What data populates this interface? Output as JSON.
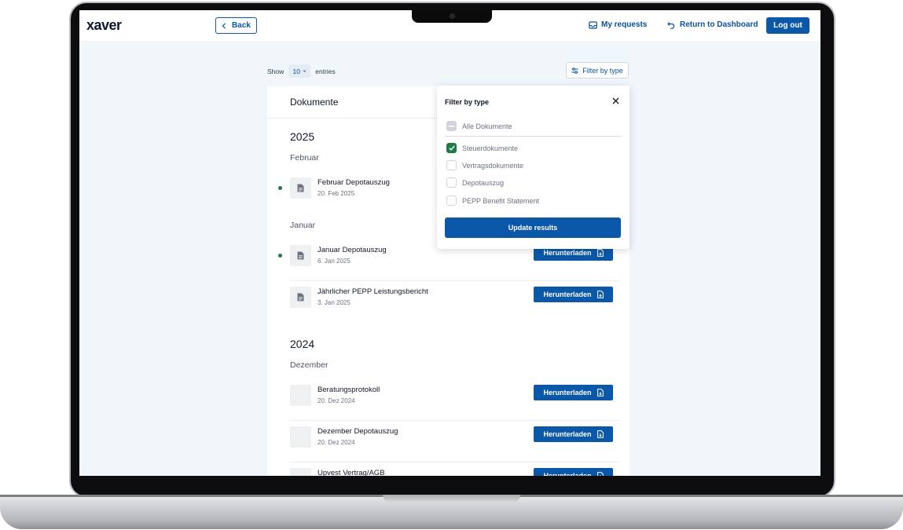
{
  "app": {
    "logo": "xaver"
  },
  "nav": {
    "back_label": "Back",
    "my_requests_label": "My requests",
    "return_label": "Return to Dashboard",
    "logout_label": "Log out"
  },
  "controls": {
    "show_label": "Show",
    "entries_value": "10",
    "entries_label": "entries",
    "filter_label": "Filter by type"
  },
  "panel": {
    "title": "Dokumente",
    "download_label": "Herunterladen",
    "groups": [
      {
        "year": "2025",
        "months": [
          {
            "name": "Februar",
            "docs": [
              {
                "name": "Februar Depotauszug",
                "date": "20. Feb 2025",
                "unread": true
              }
            ]
          },
          {
            "name": "Januar",
            "docs": [
              {
                "name": "Januar Depotauszug",
                "date": "6. Jan 2025",
                "unread": true
              },
              {
                "name": "Jährlicher PEPP Leistungsbericht",
                "date": "3. Jan 2025",
                "unread": false
              }
            ]
          }
        ]
      },
      {
        "year": "2024",
        "months": [
          {
            "name": "Dezember",
            "docs": [
              {
                "name": "Beratungsprotokoll",
                "date": "20. Dez 2024",
                "unread": false
              },
              {
                "name": "Dezember Depotauszug",
                "date": "20. Dez 2024",
                "unread": false
              },
              {
                "name": "Upvest Vertrag/AGB",
                "date": "",
                "unread": false
              }
            ]
          }
        ]
      }
    ]
  },
  "filter_popup": {
    "title": "Filter by type",
    "all_option": {
      "label": "Alle Dokumente",
      "state": "indeterminate"
    },
    "options": [
      {
        "label": "Steuerdokumente",
        "checked": true
      },
      {
        "label": "Vertragsdokumente",
        "checked": false
      },
      {
        "label": "Depotauszug",
        "checked": false
      },
      {
        "label": "PEPP Benefit Statement",
        "checked": false
      }
    ],
    "update_label": "Update results"
  },
  "colors": {
    "primary": "#0b57a8",
    "success": "#1f7a47",
    "background": "#f1f6fb"
  },
  "icons": {
    "back": "chevron-left-icon",
    "requests": "inbox-icon",
    "return": "undo-arrow-icon",
    "filter": "sliders-icon",
    "close": "close-icon",
    "document": "document-icon",
    "download": "file-download-icon",
    "check": "check-icon"
  }
}
